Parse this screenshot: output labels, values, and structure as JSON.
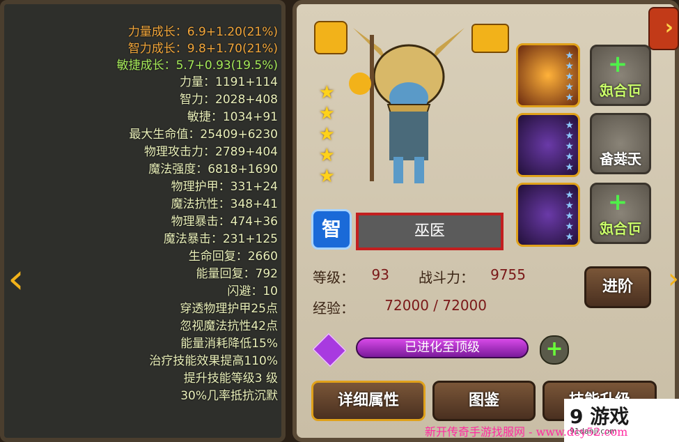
{
  "hero": {
    "name": "巫医",
    "level_label": "等级：",
    "level_value": "93",
    "power_label": "战斗力：",
    "power_value": "9755",
    "exp_label": "经验：",
    "exp_value": "72000 / 72000",
    "type_badge": "智",
    "star_count": 5
  },
  "equip": {
    "slot1_label": "可合成",
    "slot2_label": "无装备",
    "slot3_label": "可合成"
  },
  "buttons": {
    "advance": "进阶",
    "evolve_status": "已进化至顶级",
    "skill_upgrade": "技能升级",
    "handbook": "图鉴",
    "details": "详细属性"
  },
  "stats": {
    "growth": [
      "力量成长：6.9+1.20(21%)",
      "智力成长：9.8+1.70(21%)",
      "敏捷成长：5.7+0.93(19.5%)"
    ],
    "rows": [
      "力量：1191+114",
      "智力：2028+408",
      "敏捷：1034+91",
      "最大生命值：25409+6230",
      "物理攻击力：2789+404",
      "魔法强度：6818+1690",
      "物理护甲：331+24",
      "魔法抗性：348+41",
      "物理暴击：474+36",
      "魔法暴击：231+125",
      "生命回复：2660",
      "能量回复：792",
      "闪避：10",
      "穿透物理护甲25点",
      "忽视魔法抗性42点",
      "能量消耗降低15%",
      "治疗技能效果提高110%",
      "提升技能等级3 级",
      "30%几率抵抗沉默"
    ]
  },
  "watermark": {
    "left_brand": "9 游戏",
    "left_url": "91danji.com",
    "right_text": "新开传奇手游找服网 - www.dcy52.com"
  },
  "colors": {
    "growth": "#cfe86a",
    "stat": "#eaf0ba",
    "name_border": "#c21f1f",
    "evolve_bar": "#b42ad0"
  }
}
